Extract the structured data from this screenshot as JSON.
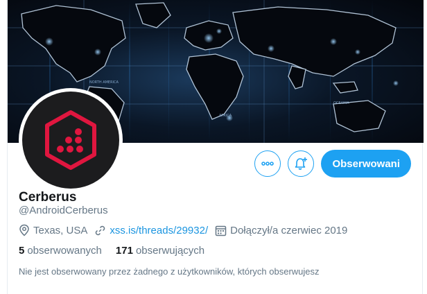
{
  "profile": {
    "name": "Cerberus",
    "handle": "@AndroidCerberus",
    "location": "Texas, USA",
    "website": "xss.is/threads/29932/",
    "joined": "Dołączył/a czerwiec 2019",
    "following_count": "5",
    "following_label": "obserwowanych",
    "followers_count": "171",
    "followers_label": "obserwujących",
    "followers_note": "Nie jest obserwowany przez żadnego z użytkowników, których obserwujesz"
  },
  "actions": {
    "more_icon": "more-dots-icon",
    "notify_icon": "bell-plus-icon",
    "follow_label": "Obserwowani"
  },
  "colors": {
    "accent": "#1da1f2",
    "link": "#1b95e0",
    "muted": "#657786",
    "avatar_logo": "#e0163f"
  }
}
